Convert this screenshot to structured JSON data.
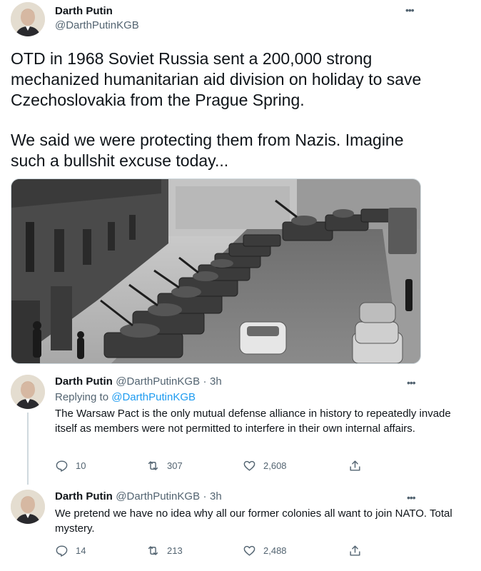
{
  "main_tweet": {
    "author_name": "Darth Putin",
    "author_handle": "@DarthPutinKGB",
    "paragraph_1": "OTD in 1968 Soviet Russia sent a 200,000 strong mechanized humanitarian aid division on holiday to save Czechoslovakia from the Prague Spring.",
    "paragraph_2": "We said we were protecting them from Nazis. Imagine such a bullshit excuse today..."
  },
  "replies": [
    {
      "author_name": "Darth Putin",
      "author_handle": "@DarthPutinKGB",
      "separator": "·",
      "time": "3h",
      "replying_prefix": "Replying to",
      "replying_handle": "@DarthPutinKGB",
      "text": "The Warsaw Pact is the only mutual defense alliance in history to repeatedly invade itself as members were not permitted to interfere in their own internal affairs.",
      "reply_count": "10",
      "retweet_count": "307",
      "like_count": "2,608"
    },
    {
      "author_name": "Darth Putin",
      "author_handle": "@DarthPutinKGB",
      "separator": "·",
      "time": "3h",
      "text": "We pretend we have no idea why all our former colonies all want to join NATO. Total mystery.",
      "reply_count": "14",
      "retweet_count": "213",
      "like_count": "2,488"
    }
  ],
  "icons": {
    "more": "more-horizontal-icon",
    "reply": "reply-icon",
    "retweet": "retweet-icon",
    "like": "heart-icon",
    "share": "share-icon"
  },
  "colors": {
    "text": "#0f1419",
    "secondary": "#536471",
    "link": "#1d9bf0",
    "thread_line": "#cfd9de"
  }
}
